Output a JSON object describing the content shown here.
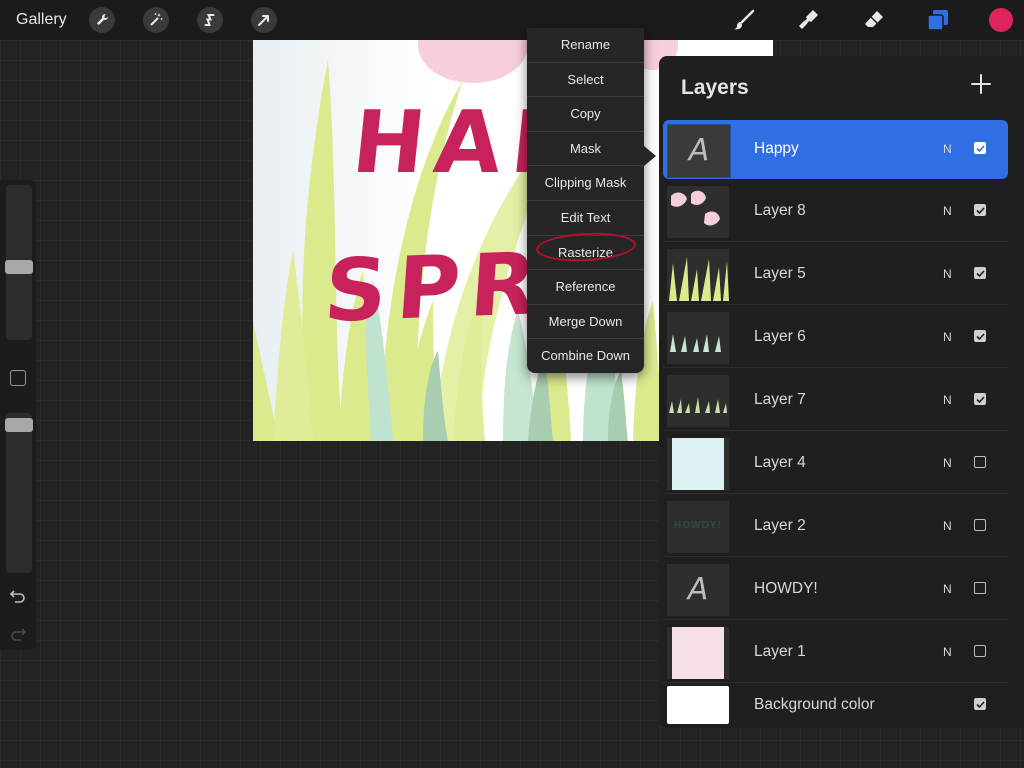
{
  "topbar": {
    "gallery_label": "Gallery",
    "left_tools": [
      "wrench-icon",
      "magic-wand-icon",
      "selection-s-icon",
      "transform-arrow-icon"
    ],
    "right_tools": [
      "brush-icon",
      "smudge-icon",
      "eraser-icon",
      "layers-icon"
    ],
    "current_color": "#e0245e",
    "active_tool_color": "#2f6fe3"
  },
  "canvas": {
    "line1": "HAP",
    "line2": "SPR",
    "text_color": "#c8225c",
    "grass_color": "#dcea8e",
    "mint_color": "#bfe3cf",
    "petal_color": "#f7d3dc"
  },
  "context_menu": {
    "items": [
      "Rename",
      "Select",
      "Copy",
      "Mask",
      "Clipping Mask",
      "Edit Text",
      "Rasterize",
      "Reference",
      "Merge Down",
      "Combine Down"
    ],
    "highlighted": "Rasterize"
  },
  "layers_panel": {
    "title": "Layers",
    "add_icon": "plus-icon",
    "rows": [
      {
        "name": "Happy",
        "blend": "N",
        "visible": true,
        "selected": true,
        "thumb": "text-layer"
      },
      {
        "name": "Layer 8",
        "blend": "N",
        "visible": true,
        "selected": false,
        "thumb": "petals"
      },
      {
        "name": "Layer 5",
        "blend": "N",
        "visible": true,
        "selected": false,
        "thumb": "grass-yellow"
      },
      {
        "name": "Layer 6",
        "blend": "N",
        "visible": true,
        "selected": false,
        "thumb": "grass-mint"
      },
      {
        "name": "Layer 7",
        "blend": "N",
        "visible": true,
        "selected": false,
        "thumb": "grass-green"
      },
      {
        "name": "Layer 4",
        "blend": "N",
        "visible": false,
        "selected": false,
        "thumb": "light-blue"
      },
      {
        "name": "Layer 2",
        "blend": "N",
        "visible": false,
        "selected": false,
        "thumb": "howdy-text",
        "thumb_text": "HOWDY!"
      },
      {
        "name": "HOWDY!",
        "blend": "N",
        "visible": false,
        "selected": false,
        "thumb": "text-layer"
      },
      {
        "name": "Layer 1",
        "blend": "N",
        "visible": false,
        "selected": false,
        "thumb": "pink"
      },
      {
        "name": "Background color",
        "blend": "",
        "visible": true,
        "selected": false,
        "thumb": "white"
      }
    ],
    "text_layer_glyph": "A"
  }
}
